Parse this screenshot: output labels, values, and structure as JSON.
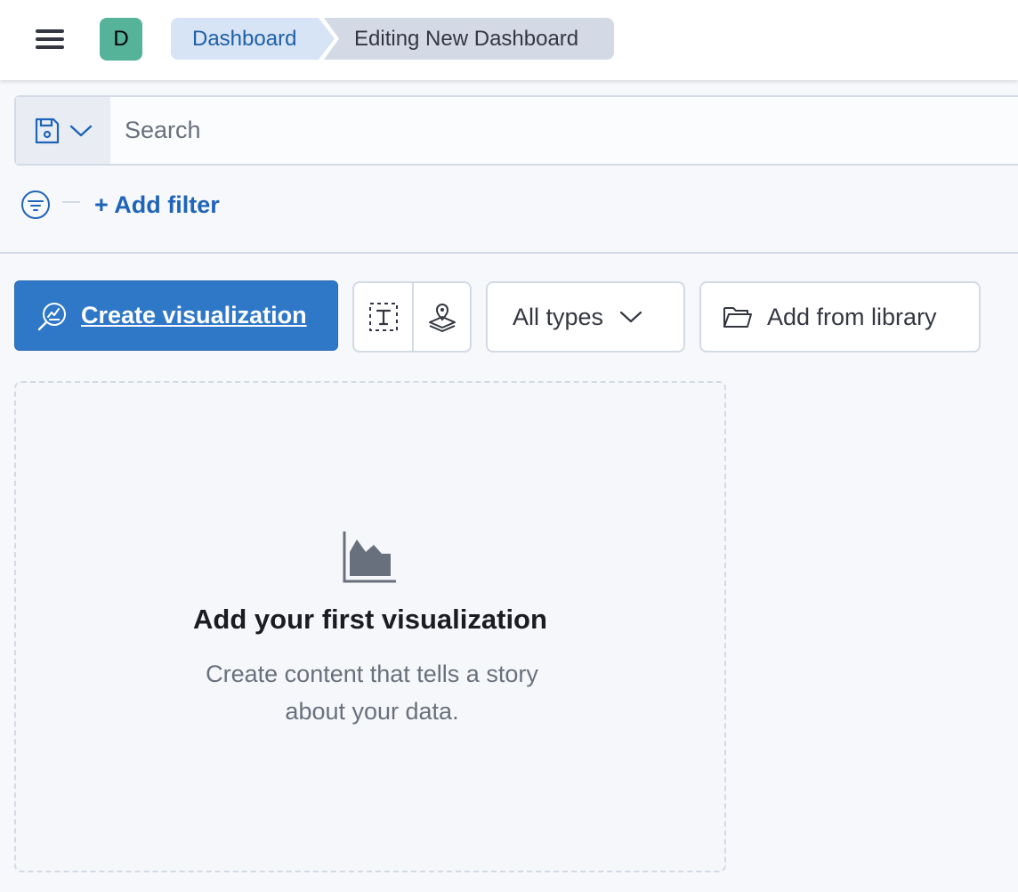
{
  "header": {
    "menu_icon": "hamburger-menu-icon",
    "avatar_letter": "D",
    "avatar_color": "#54b399",
    "breadcrumbs": [
      "Dashboard",
      "Editing New Dashboard"
    ]
  },
  "query": {
    "menu_icons": [
      "save-icon",
      "chevron-down-icon"
    ],
    "search_placeholder": "Search",
    "search_value": ""
  },
  "filters": {
    "filter_icon": "filter-icon",
    "add_filter_label": "+ Add filter"
  },
  "toolbar": {
    "create_label": "Create visualization",
    "create_color": "#2f78c8",
    "quick_icons": [
      "text-icon",
      "map-icon"
    ],
    "types_label": "All types",
    "library_label": "Add from library"
  },
  "empty_state": {
    "icon": "area-chart-icon",
    "title": "Add your first visualization",
    "description": "Create content that tells a story about your data."
  }
}
